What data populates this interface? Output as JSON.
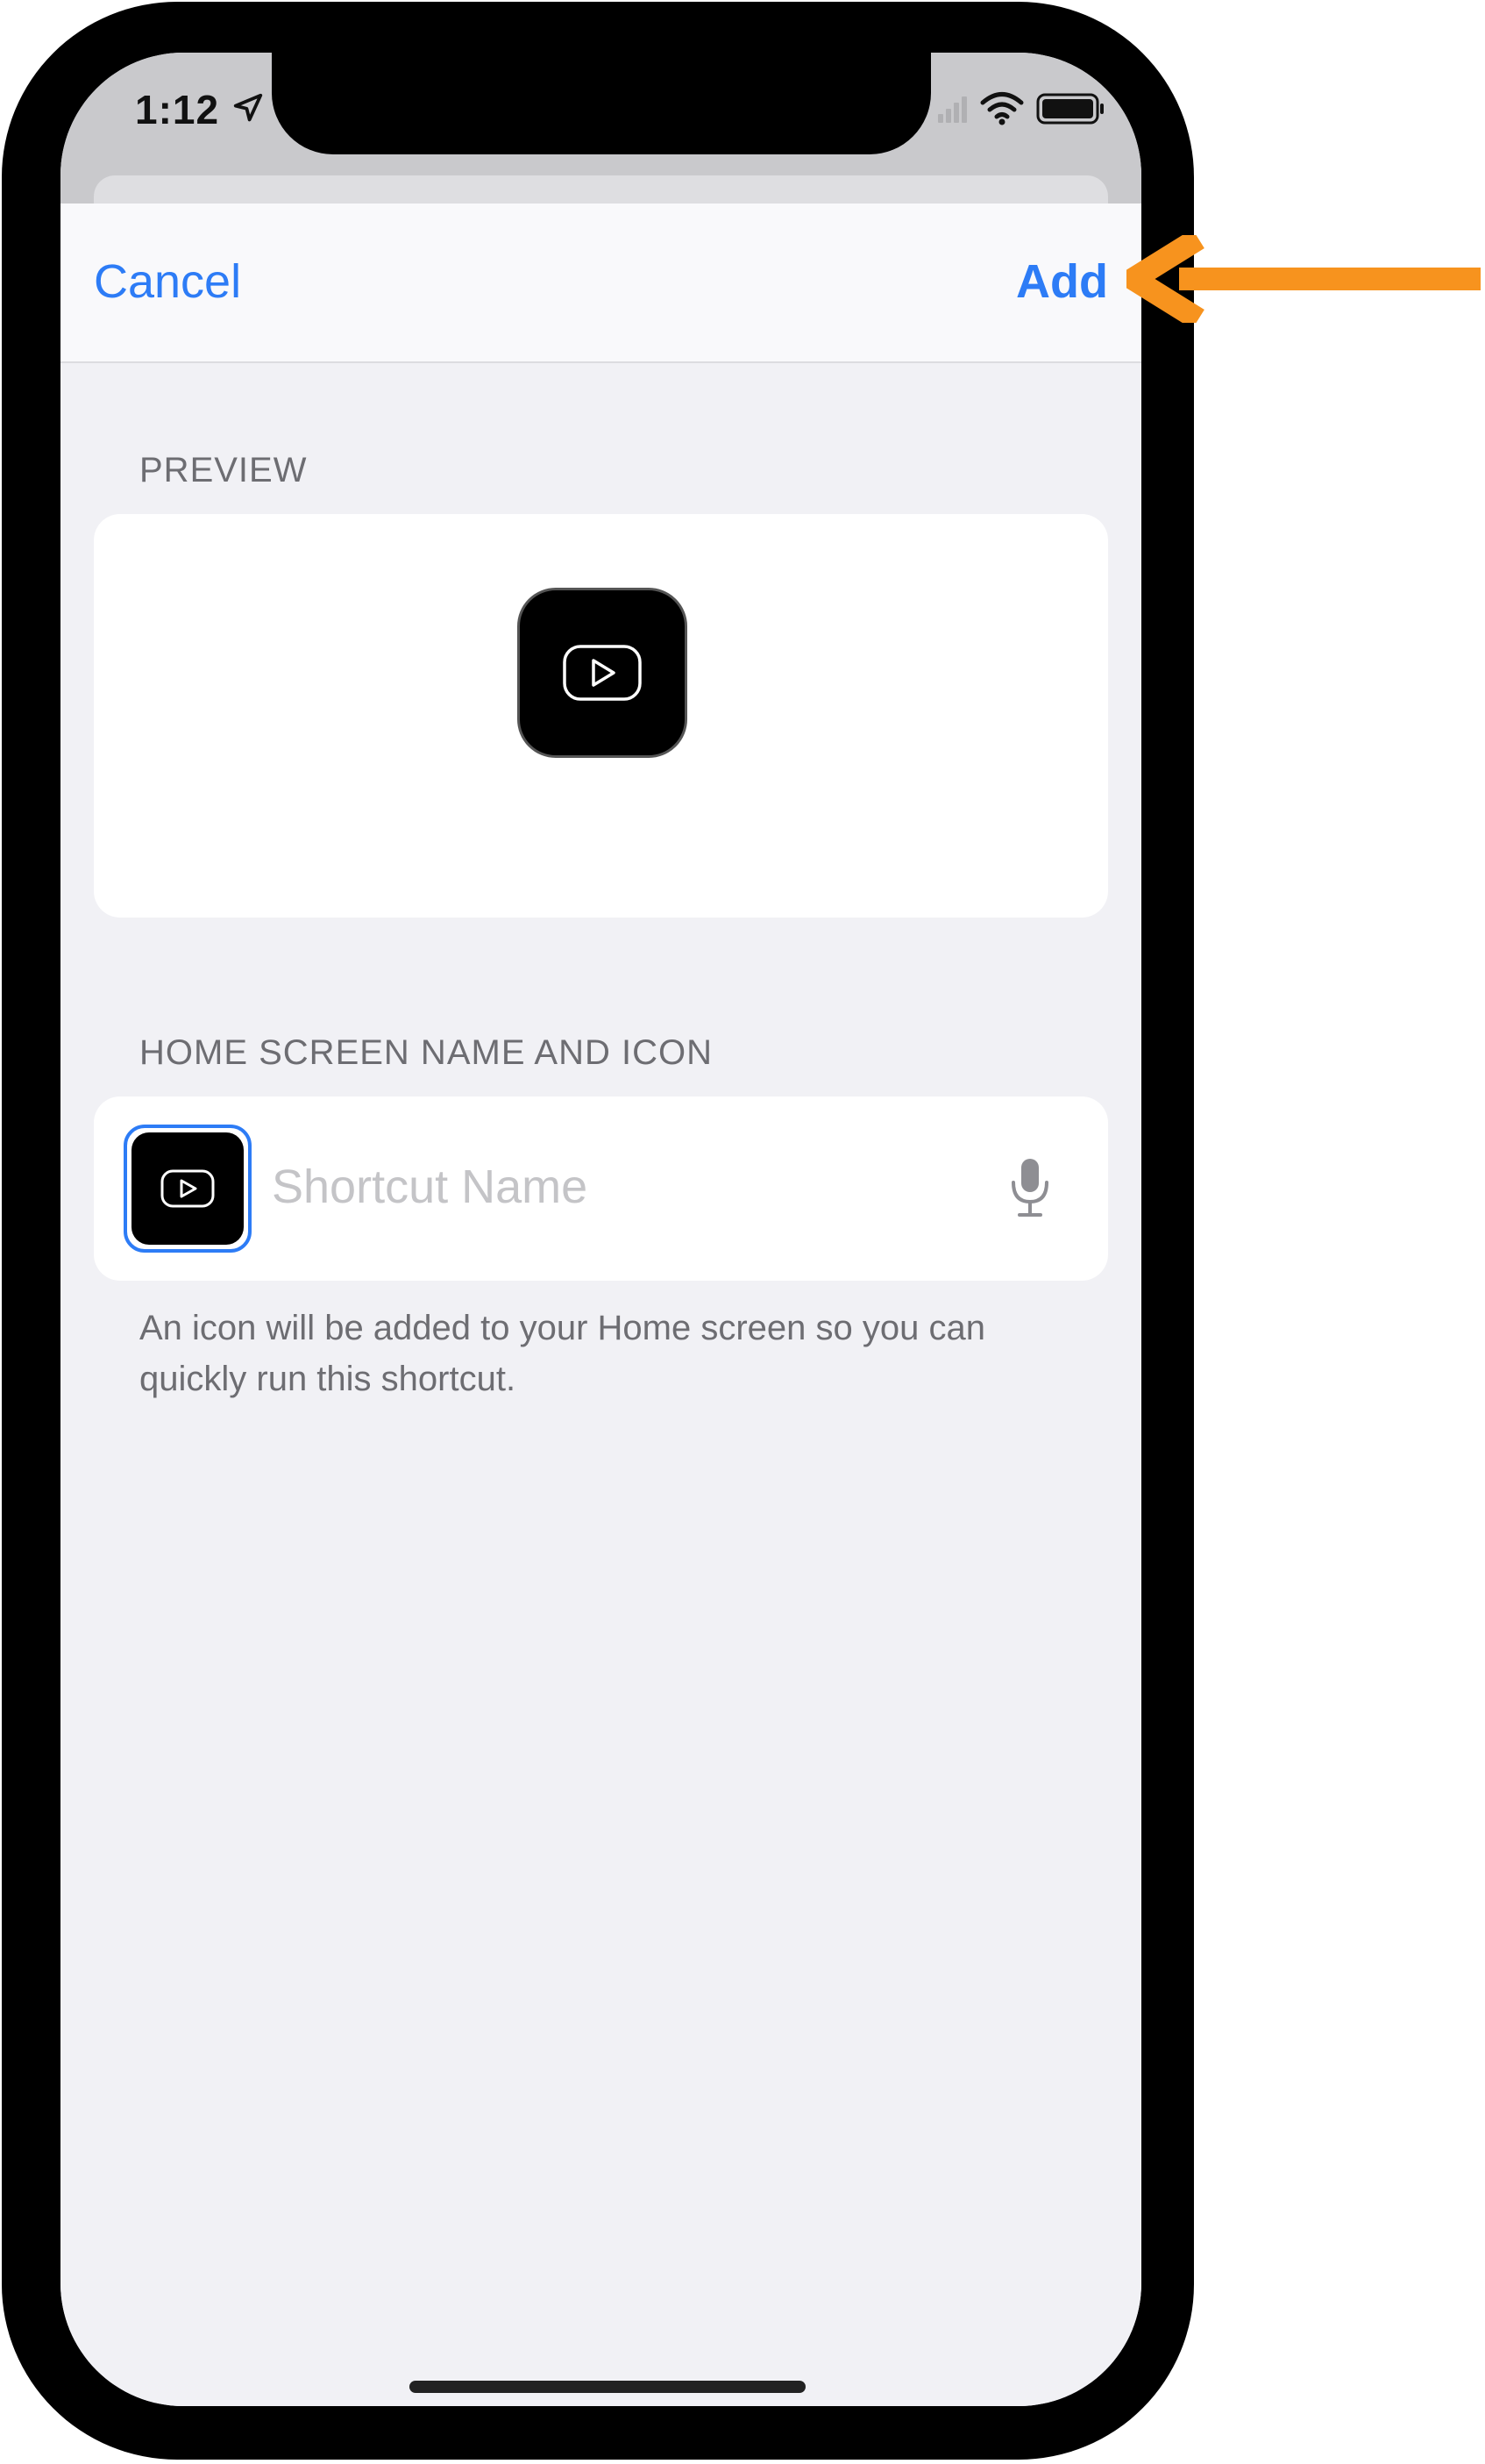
{
  "status_bar": {
    "time": "1:12"
  },
  "nav": {
    "cancel_label": "Cancel",
    "add_label": "Add"
  },
  "preview": {
    "section_label": "PREVIEW"
  },
  "home_screen": {
    "section_label": "HOME SCREEN NAME AND ICON",
    "name_placeholder": "Shortcut Name",
    "name_value": "",
    "footnote": "An icon will be added to your Home screen so you can quickly run this shortcut."
  },
  "icons": {
    "app_icon": "play-button-icon",
    "mic": "microphone-icon",
    "location": "location-arrow-icon",
    "wifi": "wifi-icon",
    "battery": "battery-icon",
    "signal": "cellular-signal-icon"
  },
  "colors": {
    "accent": "#2d7cf6",
    "annotation_arrow": "#f7931e",
    "sheet_background": "#f1f1f5",
    "card_background": "#ffffff"
  }
}
